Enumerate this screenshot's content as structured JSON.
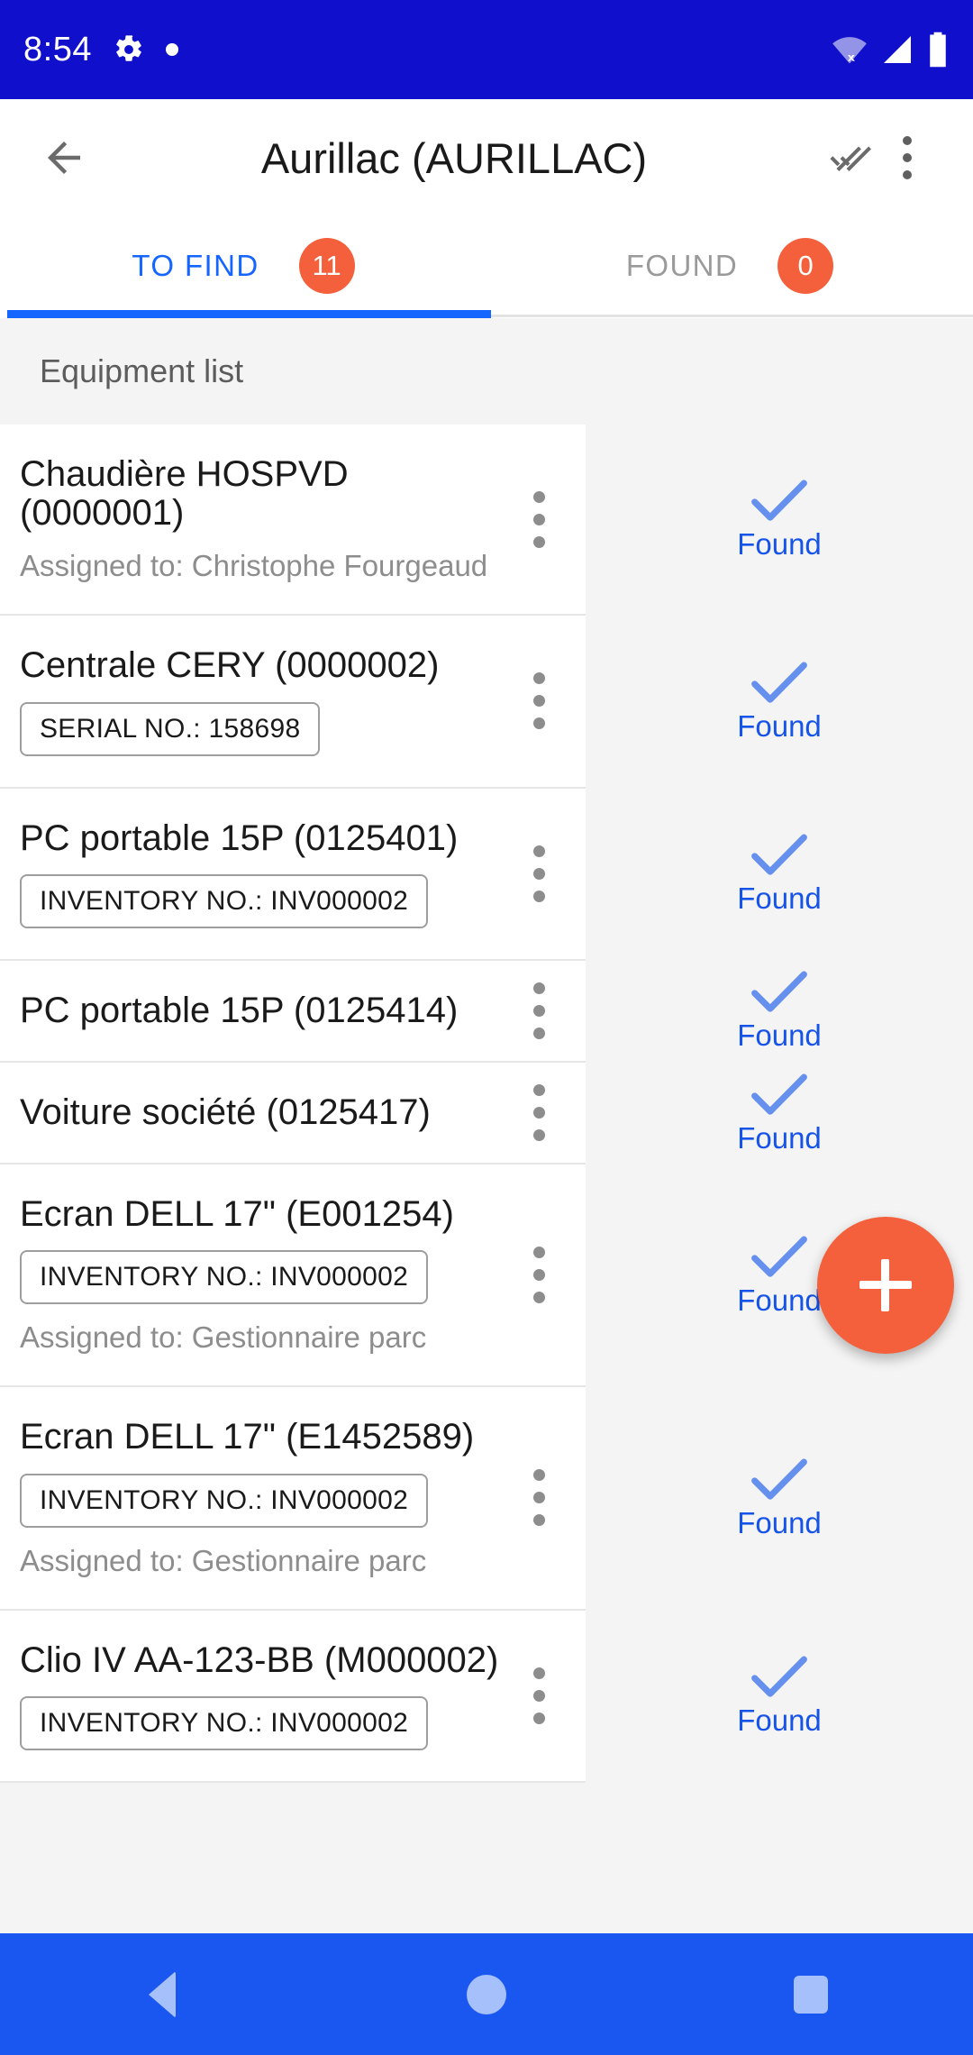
{
  "status_bar": {
    "time": "8:54",
    "icons_left": [
      "gear-icon",
      "dot-indicator-icon"
    ],
    "icons_right": [
      "wifi-off-icon",
      "cellular-signal-icon",
      "battery-icon"
    ],
    "background_color": "#1010CC"
  },
  "app_bar": {
    "back_icon": "back-arrow-icon",
    "title": "Aurillac (AURILLAC)",
    "done_all_icon": "double-check-icon",
    "overflow_icon": "more-vertical-icon"
  },
  "tabs": {
    "items": [
      {
        "label": "TO FIND",
        "badge": "11",
        "active": true
      },
      {
        "label": "FOUND",
        "badge": "0",
        "active": false
      }
    ],
    "active_color": "#1565FF",
    "inactive_color": "#9A9A9A",
    "badge_color": "#F4603C"
  },
  "section": {
    "header": "Equipment list"
  },
  "list": {
    "found_label": "Found",
    "items": [
      {
        "title": "Chaudière HOSPVD (0000001)",
        "chip": null,
        "assigned": "Assigned to: Christophe Fourgeaud",
        "status": "Found"
      },
      {
        "title": "Centrale CERY (0000002)",
        "chip": "SERIAL NO.: 158698",
        "assigned": null,
        "status": "Found"
      },
      {
        "title": "PC portable 15P (0125401)",
        "chip": "INVENTORY NO.: INV000002",
        "assigned": null,
        "status": "Found"
      },
      {
        "title": "PC portable 15P (0125414)",
        "chip": null,
        "assigned": null,
        "status": "Found"
      },
      {
        "title": "Voiture société (0125417)",
        "chip": null,
        "assigned": null,
        "status": "Found"
      },
      {
        "title": "Ecran DELL 17\" (E001254)",
        "chip": "INVENTORY NO.: INV000002",
        "assigned": "Assigned to: Gestionnaire parc",
        "status": "Found"
      },
      {
        "title": "Ecran DELL 17\" (E1452589)",
        "chip": "INVENTORY NO.: INV000002",
        "assigned": "Assigned to: Gestionnaire parc",
        "status": "Found"
      },
      {
        "title": "Clio IV AA-123-BB (M000002)",
        "chip": "INVENTORY NO.: INV000002",
        "assigned": null,
        "status": "Found"
      }
    ]
  },
  "fab": {
    "icon": "plus-icon",
    "color": "#F4603C"
  },
  "nav_bar": {
    "background_color": "#1A56F0",
    "buttons": [
      "back-triangle-icon",
      "home-circle-icon",
      "recents-square-icon"
    ]
  }
}
